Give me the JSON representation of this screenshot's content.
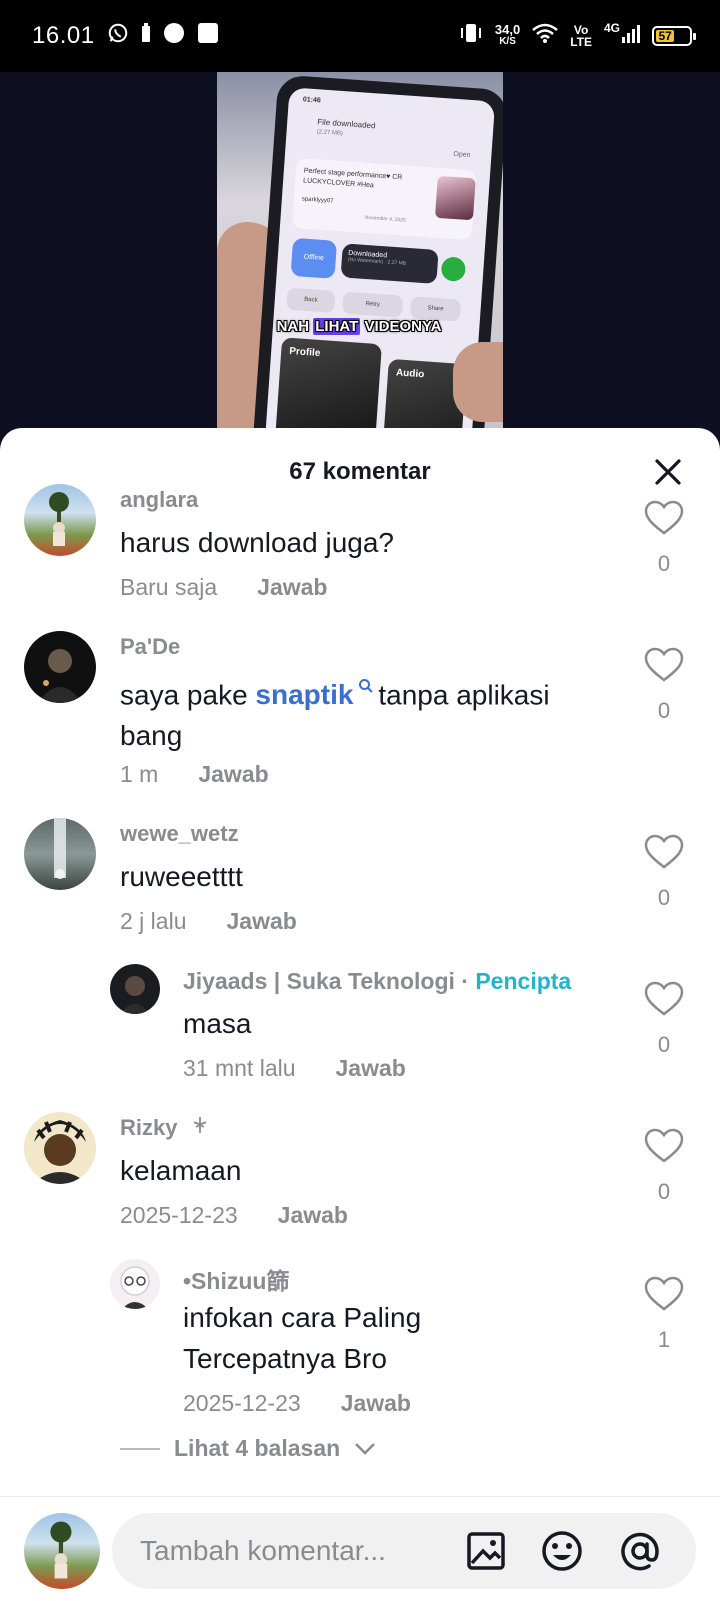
{
  "status_bar": {
    "time": "16.01",
    "net_speed_value": "34,0",
    "net_speed_unit": "K/S",
    "volte": "Vo",
    "volte2": "LTE",
    "network": "4G",
    "battery": "57"
  },
  "video": {
    "caption_prefix": "NAH ",
    "caption_highlight": "LIHAT",
    "caption_suffix": " VIDEONYA",
    "phone_screen": {
      "time": "01:46",
      "file_downloaded": "File downloaded",
      "size": "(2.27 MB)",
      "open": "Open",
      "post_title": "Perfect stage performance♥ CR LUCKYCLOVER #Hea",
      "post_user": "sparklyyy07",
      "post_date": "November 4, 2025",
      "btn_blue": "Offline",
      "btn_dark_title": "Downloaded",
      "btn_dark_sub": "(No Watermark) · 2.27 MB",
      "back": "Back",
      "retry": "Retry",
      "share": "Share",
      "profile": "Profile",
      "audio": "Audio"
    }
  },
  "sheet": {
    "title": "67 komentar"
  },
  "comments": [
    {
      "user": "anglara",
      "text": "harus download juga?",
      "time": "Baru saja",
      "reply": "Jawab",
      "likes": "0"
    },
    {
      "user": "Pa'De",
      "text_before": "saya pake ",
      "text_link": "snaptik",
      "text_after": " tanpa aplikasi bang",
      "time": "1 m",
      "reply": "Jawab",
      "likes": "0"
    },
    {
      "user": "wewe_wetz",
      "text": "ruweeetttt",
      "time": "2 j lalu",
      "reply": "Jawab",
      "likes": "0"
    },
    {
      "user": "Jiyaads | Suka Teknologi",
      "sep": " · ",
      "creator": "Pencipta",
      "text": "masa",
      "time": "31 mnt lalu",
      "reply": "Jawab",
      "likes": "0"
    },
    {
      "user": "Rizky",
      "text": "kelamaan",
      "time": "2025-12-23",
      "reply": "Jawab",
      "likes": "0"
    },
    {
      "user": "•Shizuu篩",
      "text": "infokan cara Paling Tercepatnya Bro",
      "time": "2025-12-23",
      "reply": "Jawab",
      "likes": "1"
    }
  ],
  "more_replies": "Lihat 4 balasan",
  "input": {
    "placeholder": "Tambah komentar..."
  },
  "colors": {
    "link": "#3a6ed0",
    "creator_badge": "#20b5c8",
    "muted": "#8a8b91"
  }
}
